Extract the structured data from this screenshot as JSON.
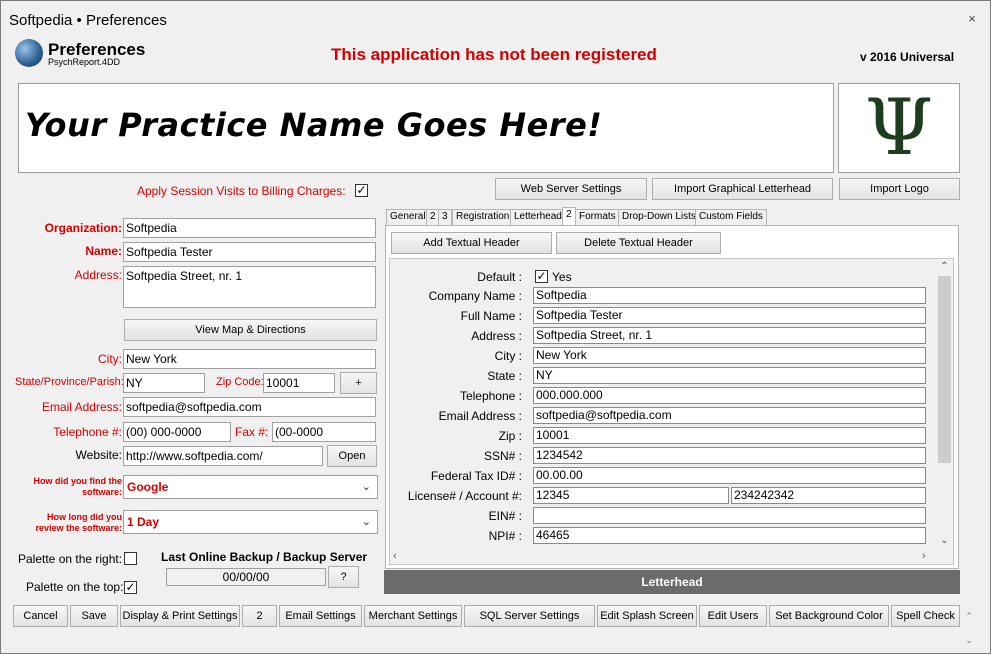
{
  "window": {
    "title": "Softpedia  • Preferences",
    "close_glyph": "×"
  },
  "header": {
    "title": "Preferences",
    "subtitle": "PsychReport.4DD",
    "registration_warning": "This application has not been registered",
    "version": "v 2016 Universal"
  },
  "banner": {
    "practice_name": "Your Practice Name Goes Here!",
    "logo_glyph": "Ψ"
  },
  "apply_session": {
    "label": "Apply Session Visits to Billing Charges:",
    "checked": "✓"
  },
  "top_buttons": {
    "web_server": "Web Server Settings",
    "import_letterhead": "Import Graphical Letterhead",
    "import_logo": "Import Logo"
  },
  "form": {
    "organization_label": "Organization:",
    "organization_value": "Softpedia",
    "name_label": "Name:",
    "name_value": "Softpedia Tester",
    "address_label": "Address:",
    "address_value": "Softpedia Street, nr. 1",
    "view_map": "View Map & Directions",
    "city_label": "City:",
    "city_value": "New York",
    "state_label": "State/Province/Parish:",
    "state_value": "NY",
    "zip_label": "Zip Code:",
    "zip_value": "10001",
    "plus": "+",
    "email_label": "Email Address:",
    "email_value": "softpedia@softpedia.com",
    "telephone_label": "Telephone #:",
    "telephone_value": "(00) 000-0000",
    "fax_label": "Fax #:",
    "fax_value": "(00-0000",
    "website_label": "Website:",
    "website_value": "http://www.softpedia.com/",
    "open": "Open",
    "found_label_1": "How did you find the",
    "found_label_2": "software:",
    "found_value": "Google",
    "review_label_1": "How long did you",
    "review_label_2": "review the software:",
    "review_value": "1 Day",
    "palette_right": "Palette on the right:",
    "palette_top": "Palette on the top:",
    "palette_top_checked": "✓",
    "backup_label": "Last Online Backup / Backup Server",
    "backup_value": "00/00/00",
    "backup_help": "?"
  },
  "tabs": [
    "General",
    "2",
    "3",
    "Registration",
    "Letterhead",
    "2",
    "Formats",
    "Drop-Down Lists",
    "Custom Fields"
  ],
  "letterhead": {
    "add_header": "Add Textual Header",
    "delete_header": "Delete Textual Header",
    "default_label": "Default :",
    "default_checked": "✓",
    "default_value": "Yes",
    "fields": [
      {
        "label": "Company Name :",
        "value": "Softpedia"
      },
      {
        "label": "Full Name :",
        "value": "Softpedia Tester"
      },
      {
        "label": "Address :",
        "value": "Softpedia Street, nr. 1"
      },
      {
        "label": "City :",
        "value": "New York"
      },
      {
        "label": "State :",
        "value": "NY"
      },
      {
        "label": "Telephone :",
        "value": "000.000.000"
      },
      {
        "label": "Email Address :",
        "value": "softpedia@softpedia.com"
      },
      {
        "label": "Zip :",
        "value": "10001"
      },
      {
        "label": "SSN# :",
        "value": "1234542"
      },
      {
        "label": "Federal Tax ID# :",
        "value": "00.00.00"
      }
    ],
    "license_label": "License# / Account #:",
    "license_value": "12345",
    "account_value": "234242342",
    "ein_label": "EIN# :",
    "ein_value": "",
    "npi_label": "NPI# :",
    "npi_value": "46465",
    "footer": "Letterhead"
  },
  "bottom_buttons": [
    "Cancel",
    "Save",
    "Display & Print Settings",
    "2",
    "Email Settings",
    "Merchant Settings",
    "SQL Server Settings",
    "Edit Splash Screen",
    "Edit Users",
    "Set Background Color",
    "Spell Check"
  ],
  "colors": {
    "accent_red": "#d40000",
    "footer_bar": "#6b6b6b"
  }
}
